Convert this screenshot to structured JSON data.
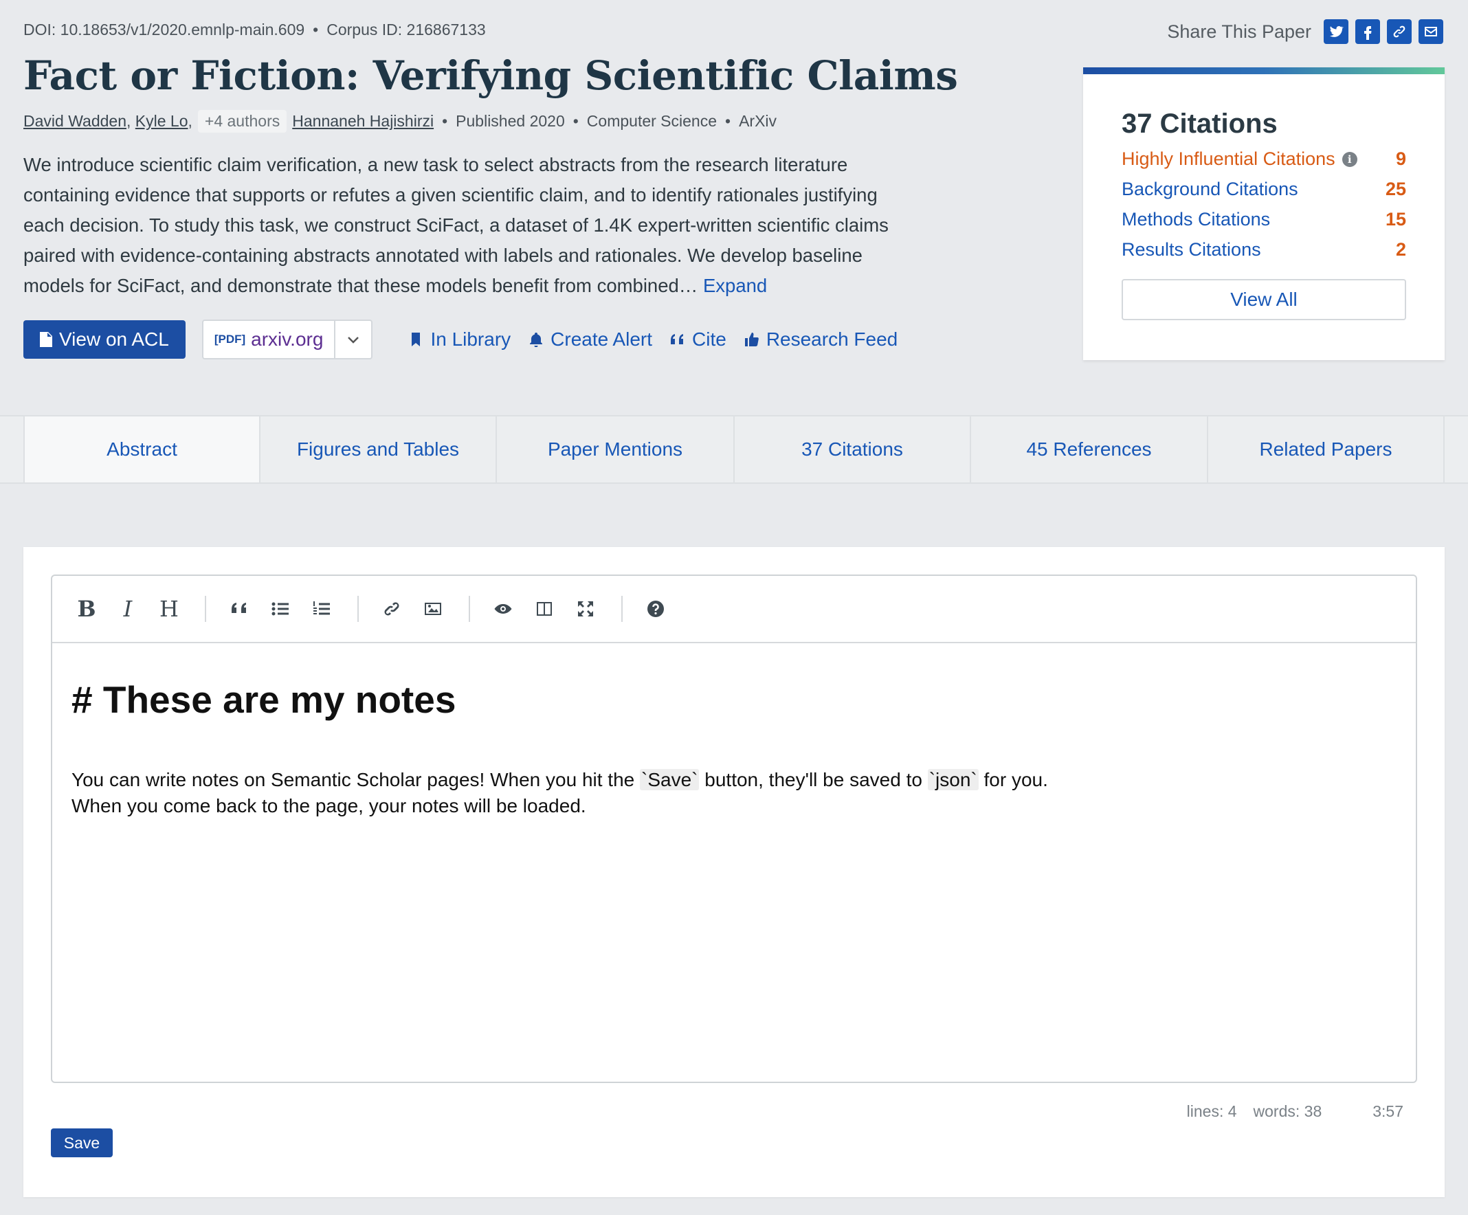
{
  "paper": {
    "doi": "DOI: 10.18653/v1/2020.emnlp-main.609",
    "corpus_id": "Corpus ID: 216867133",
    "title": "Fact or Fiction: Verifying Scientific Claims",
    "authors": [
      "David Wadden",
      "Kyle Lo"
    ],
    "more_authors": "+4 authors",
    "last_author": "Hannaneh Hajishirzi",
    "published": "Published 2020",
    "field": "Computer Science",
    "venue": "ArXiv",
    "abstract": "We introduce scientific claim verification, a new task to select abstracts from the research literature containing evidence that supports or refutes a given scientific claim, and to identify rationales justifying each decision. To study this task, we construct SciFact, a dataset of 1.4K expert-written scientific claims paired with evidence-containing abstracts annotated with labels and rationales. We develop baseline models for SciFact, and demonstrate that these models benefit from combined…",
    "expand_label": "Expand"
  },
  "share": {
    "label": "Share This Paper",
    "icons": [
      "twitter-icon",
      "facebook-icon",
      "link-icon",
      "email-icon"
    ]
  },
  "actions": {
    "view_label": "View on ACL",
    "pdf_tag": "[PDF]",
    "pdf_source": "arxiv.org",
    "library": "In Library",
    "alert": "Create Alert",
    "cite": "Cite",
    "feed": "Research Feed"
  },
  "citations": {
    "title": "37 Citations",
    "rows": [
      {
        "label": "Highly Influential Citations",
        "value": "9"
      },
      {
        "label": "Background Citations",
        "value": "25"
      },
      {
        "label": "Methods Citations",
        "value": "15"
      },
      {
        "label": "Results Citations",
        "value": "2"
      }
    ],
    "view_all": "View All"
  },
  "tabs": [
    "Abstract",
    "Figures and Tables",
    "Paper Mentions",
    "37 Citations",
    "45 References",
    "Related Papers"
  ],
  "notes": {
    "heading": "# These are my notes",
    "line1_a": "You can write notes on Semantic Scholar pages! When you hit the ",
    "line1_code1": "`Save`",
    "line1_b": " button, they'll be saved to ",
    "line1_code2": "`json`",
    "line1_c": " for you.",
    "line2": "When you come back to the page, your notes will be loaded.",
    "status_lines": "lines: 4",
    "status_words": "words: 38",
    "status_cursor": "3:57",
    "save_label": "Save"
  },
  "colors": {
    "primary": "#1c4ea3",
    "link": "#1857b6",
    "accent_orange": "#d85b15"
  }
}
